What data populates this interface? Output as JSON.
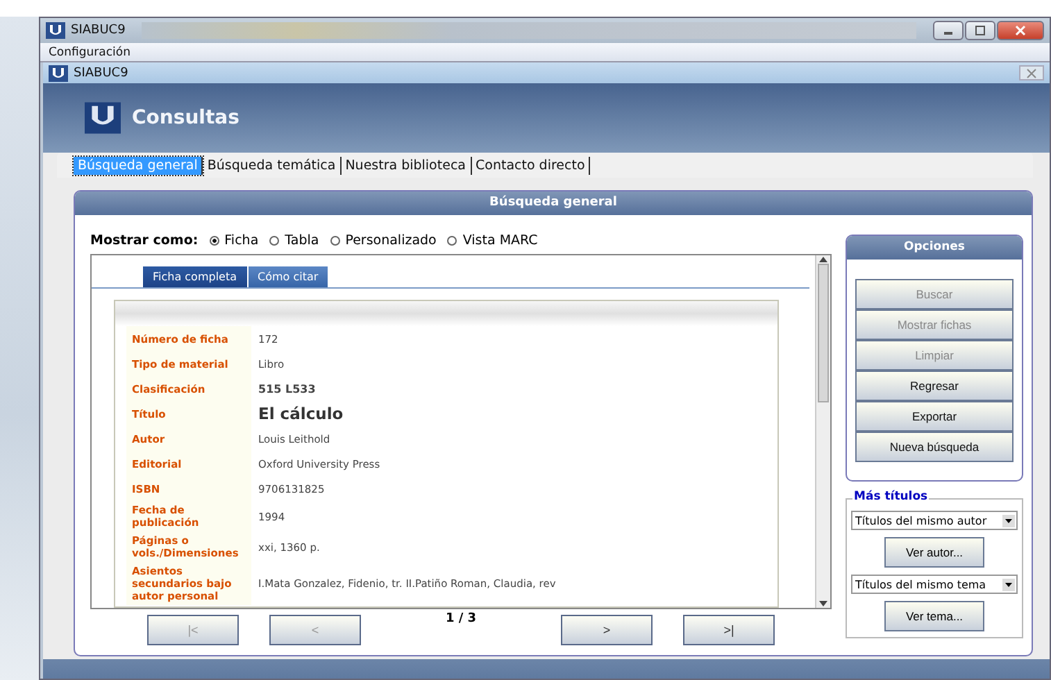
{
  "outer_window": {
    "title": "SIABUC9"
  },
  "menu": [
    "Configuración"
  ],
  "inner_window": {
    "title": "SIABUC9"
  },
  "header": {
    "title": "Consultas"
  },
  "tabs": [
    {
      "label": "Búsqueda general",
      "selected": true
    },
    {
      "label": "Búsqueda temática",
      "selected": false
    },
    {
      "label": "Nuestra biblioteca",
      "selected": false
    },
    {
      "label": "Contacto directo",
      "selected": false
    }
  ],
  "panel": {
    "title": "Búsqueda general",
    "show_as": {
      "label": "Mostrar como:",
      "options": [
        {
          "label": "Ficha",
          "selected": true
        },
        {
          "label": "Tabla",
          "selected": false
        },
        {
          "label": "Personalizado",
          "selected": false
        },
        {
          "label": "Vista MARC",
          "selected": false
        }
      ]
    },
    "record_tabs": [
      {
        "label": "Ficha completa",
        "selected": true
      },
      {
        "label": "Cómo citar",
        "selected": false
      }
    ],
    "fields": [
      {
        "label": "Número de ficha",
        "value": "172",
        "kind": "plain"
      },
      {
        "label": "Tipo de material",
        "value": "Libro",
        "kind": "plain"
      },
      {
        "label": "Clasificación",
        "value": "515 L533",
        "kind": "bold"
      },
      {
        "label": "Título",
        "value": "El cálculo",
        "kind": "title"
      },
      {
        "label": "Autor",
        "value": "Louis Leithold",
        "kind": "plain"
      },
      {
        "label": "Editorial",
        "value": "Oxford University Press",
        "kind": "plain"
      },
      {
        "label": "ISBN",
        "value": "9706131825",
        "kind": "plain"
      },
      {
        "label": "Fecha de publicación",
        "value": "1994",
        "kind": "plain"
      },
      {
        "label": "Páginas o vols./Dimensiones",
        "value": "xxi, 1360 p.",
        "kind": "plain"
      },
      {
        "label": "Asientos secundarios bajo autor personal",
        "value": "I.Mata Gonzalez, Fidenio, tr. II.Patiño Roman, Claudia, rev",
        "kind": "plain"
      }
    ],
    "pager": {
      "first": {
        "label": "|<",
        "disabled": true
      },
      "prev": {
        "label": "<",
        "disabled": true
      },
      "page": "1 / 3",
      "next": {
        "label": ">",
        "disabled": false
      },
      "last": {
        "label": ">|",
        "disabled": false
      }
    }
  },
  "options": {
    "title": "Opciones",
    "buttons": [
      {
        "label": "Buscar",
        "disabled": true
      },
      {
        "label": "Mostrar fichas",
        "disabled": true
      },
      {
        "label": "Limpiar",
        "disabled": true
      },
      {
        "label": "Regresar",
        "disabled": false
      },
      {
        "label": "Exportar",
        "disabled": false
      },
      {
        "label": "Nueva búsqueda",
        "disabled": false
      }
    ]
  },
  "more_titles": {
    "title": "Más títulos",
    "author_select": "Títulos del mismo autor",
    "author_button": "Ver autor...",
    "topic_select": "Títulos del mismo tema",
    "topic_button": "Ver tema..."
  }
}
